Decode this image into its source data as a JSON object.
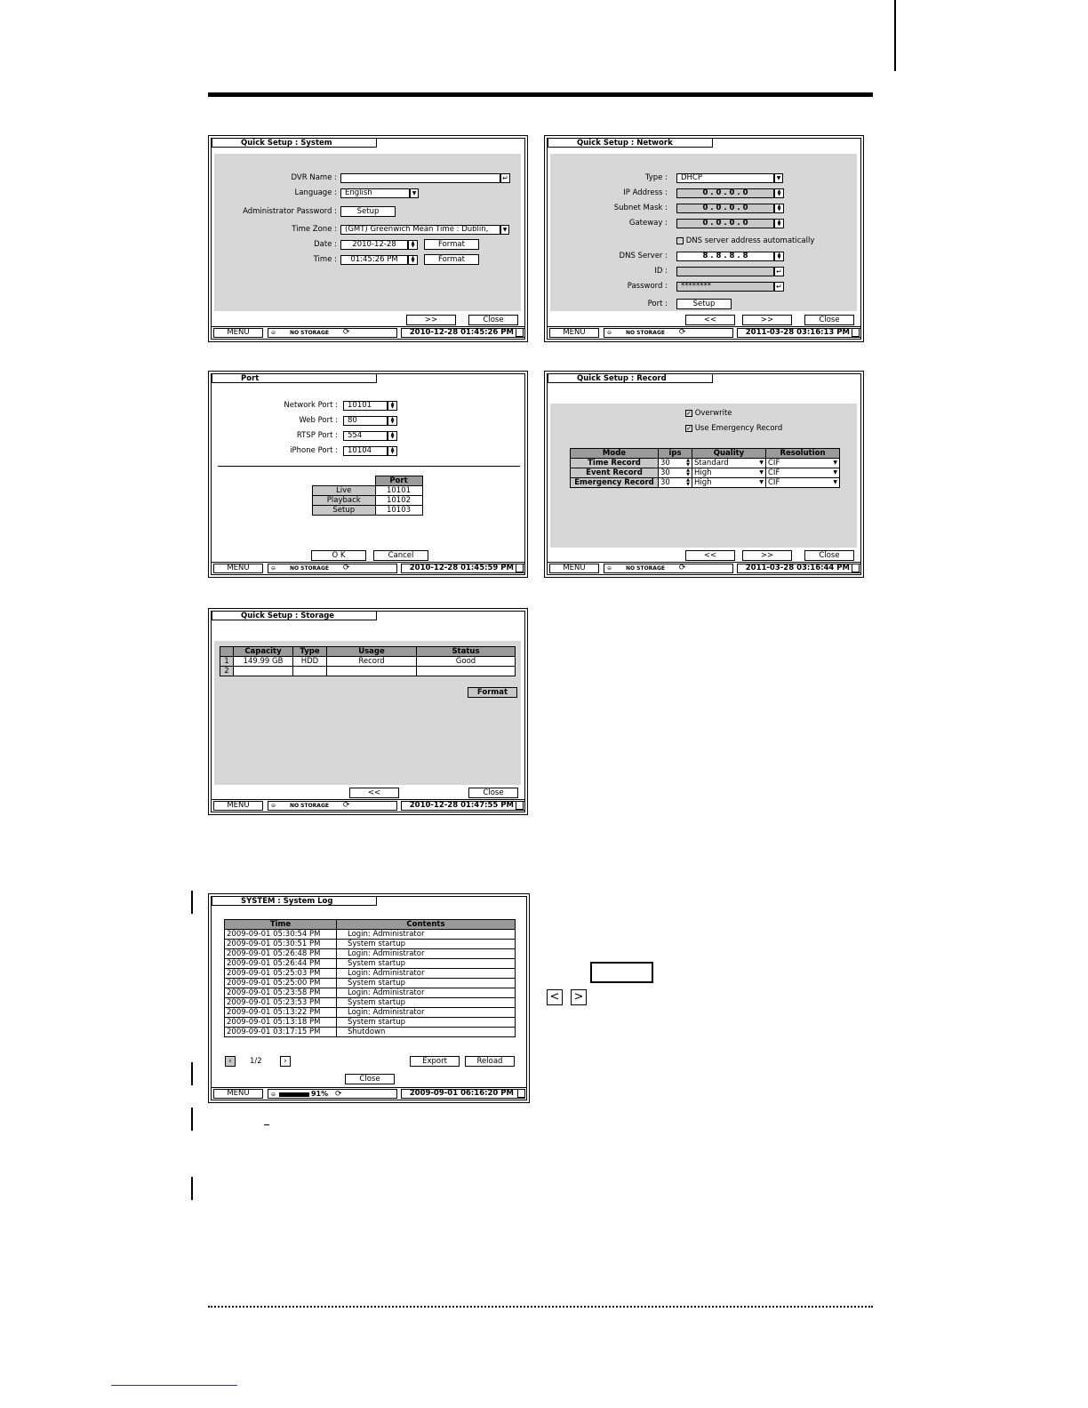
{
  "system": {
    "title": "Quick Setup : System",
    "dvr_name_label": "DVR Name :",
    "dvr_name_value": "",
    "language_label": "Language :",
    "language_value": "English",
    "admin_password_label": "Administrator Password :",
    "setup_button": "Setup",
    "time_zone_label": "Time Zone :",
    "time_zone_value": "(GMT) Greenwich Mean Time : Dublin,",
    "date_label": "Date :",
    "date_value": "2010-12-28",
    "time_label": "Time :",
    "time_value": "01:45:26 PM",
    "format_button": "Format",
    "next_button": ">>",
    "close_button": "Close",
    "status_time": "2010-12-28 01:45:26 PM"
  },
  "network": {
    "title": "Quick Setup : Network",
    "type_label": "Type :",
    "type_value": "DHCP",
    "ip_label": "IP Address :",
    "ip_value": "0 . 0 . 0 . 0",
    "subnet_label": "Subnet Mask :",
    "subnet_value": "0 . 0 . 0 . 0",
    "gateway_label": "Gateway :",
    "gateway_value": "0 . 0 . 0 . 0",
    "dns_auto_label": "DNS server address automatically",
    "dns_label": "DNS Server :",
    "dns_value": "8 . 8 . 8 . 8",
    "id_label": "ID :",
    "id_value": "",
    "password_label": "Password :",
    "password_value": "********",
    "port_label": "Port :",
    "setup_button": "Setup",
    "prev_button": "<<",
    "next_button": ">>",
    "close_button": "Close",
    "status_time": "2011-03-28 03:16:13 PM"
  },
  "port": {
    "title": "Port",
    "network_port_label": "Network Port :",
    "network_port_value": "10101",
    "web_port_label": "Web Port :",
    "web_port_value": "80",
    "rtsp_port_label": "RTSP Port :",
    "rtsp_port_value": "554",
    "iphone_port_label": "iPhone Port :",
    "iphone_port_value": "10104",
    "table_header": "Port",
    "rows": [
      {
        "name": "Live",
        "value": "10101"
      },
      {
        "name": "Playback",
        "value": "10102"
      },
      {
        "name": "Setup",
        "value": "10103"
      }
    ],
    "ok_button": "O K",
    "cancel_button": "Cancel",
    "status_time": "2010-12-28 01:45:59 PM"
  },
  "record": {
    "title": "Quick Setup : Record",
    "overwrite_label": "Overwrite",
    "emergency_label": "Use Emergency Record",
    "headers": [
      "Mode",
      "ips",
      "Quality",
      "Resolution"
    ],
    "rows": [
      {
        "mode": "Time Record",
        "ips": "30",
        "quality": "Standard",
        "resolution": "CIF"
      },
      {
        "mode": "Event Record",
        "ips": "30",
        "quality": "High",
        "resolution": "CIF"
      },
      {
        "mode": "Emergency Record",
        "ips": "30",
        "quality": "High",
        "resolution": "CIF"
      }
    ],
    "prev_button": "<<",
    "next_button": ">>",
    "close_button": "Close",
    "status_time": "2011-03-28 03:16:44 PM"
  },
  "storage": {
    "title": "Quick Setup : Storage",
    "headers": [
      "Capacity",
      "Type",
      "Usage",
      "Status"
    ],
    "rows": [
      {
        "no": "1",
        "capacity": "149.99 GB",
        "type": "HDD",
        "usage": "Record",
        "status": "Good"
      },
      {
        "no": "2",
        "capacity": "",
        "type": "",
        "usage": "",
        "status": ""
      }
    ],
    "format_button": "Format",
    "prev_button": "<<",
    "close_button": "Close",
    "status_time": "2010-12-28 01:47:55 PM"
  },
  "syslog": {
    "title": "SYSTEM : System Log",
    "headers": [
      "Time",
      "Contents"
    ],
    "rows": [
      {
        "time": "2009-09-01  05:30:54 PM",
        "contents": "Login: Administrator"
      },
      {
        "time": "2009-09-01  05:30:51 PM",
        "contents": "System startup"
      },
      {
        "time": "2009-09-01  05:26:48 PM",
        "contents": "Login: Administrator"
      },
      {
        "time": "2009-09-01  05:26:44 PM",
        "contents": "System startup"
      },
      {
        "time": "2009-09-01  05:25:03 PM",
        "contents": "Login: Administrator"
      },
      {
        "time": "2009-09-01  05:25:00 PM",
        "contents": "System startup"
      },
      {
        "time": "2009-09-01  05:23:58 PM",
        "contents": "Login: Administrator"
      },
      {
        "time": "2009-09-01  05:23:53 PM",
        "contents": "System startup"
      },
      {
        "time": "2009-09-01  05:13:22 PM",
        "contents": "Login: Administrator"
      },
      {
        "time": "2009-09-01  05:13:18 PM",
        "contents": "System startup"
      },
      {
        "time": "2009-09-01  03:17:15 PM",
        "contents": "Shutdown"
      }
    ],
    "page_indicator": "1/2",
    "export_button": "Export",
    "reload_button": "Reload",
    "close_button": "Close",
    "storage_percent": "91%",
    "status_time": "2009-09-01 06:16:20 PM"
  },
  "statusbar": {
    "menu_label": "MENU",
    "no_storage": "NO STORAGE"
  },
  "legend": {
    "prev_glyph": "<",
    "next_glyph": ">"
  }
}
